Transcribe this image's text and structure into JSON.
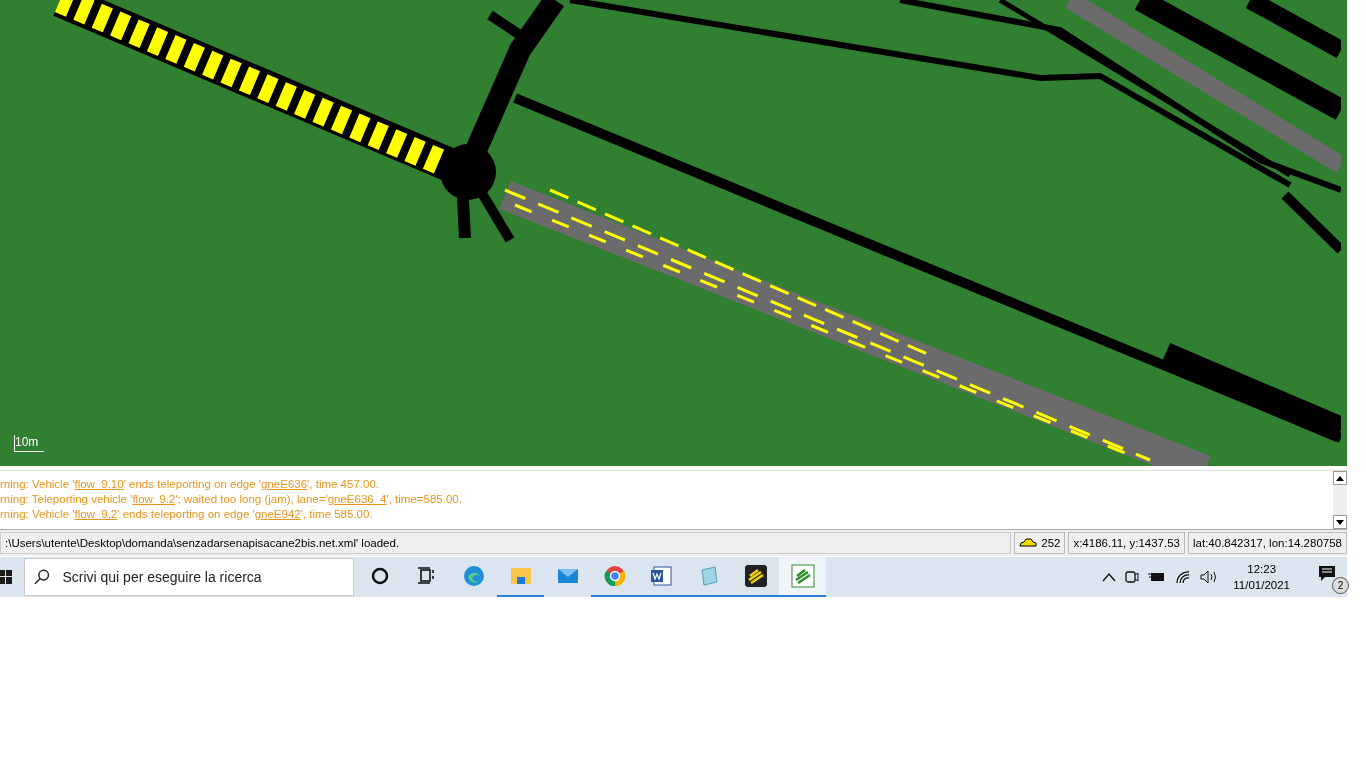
{
  "map": {
    "scale_label": "10m"
  },
  "messages": [
    [
      {
        "text": "rning: Vehicle '",
        "link": false
      },
      {
        "text": "flow_9.10",
        "link": true
      },
      {
        "text": "' ends teleporting on edge '",
        "link": false
      },
      {
        "text": "gneE636",
        "link": true
      },
      {
        "text": "', time 457.00.",
        "link": false
      }
    ],
    [
      {
        "text": "rning: Teleporting vehicle '",
        "link": false
      },
      {
        "text": "flow_9.2",
        "link": true
      },
      {
        "text": "'; waited too long (jam), lane='",
        "link": false
      },
      {
        "text": "gneE636_4",
        "link": true
      },
      {
        "text": "', time=585.00.",
        "link": false
      }
    ],
    [
      {
        "text": "rning: Vehicle '",
        "link": false
      },
      {
        "text": "flow_9.2",
        "link": true
      },
      {
        "text": "' ends teleporting on edge '",
        "link": false
      },
      {
        "text": "gneE942",
        "link": true
      },
      {
        "text": "', time 585.00.",
        "link": false
      }
    ]
  ],
  "status_bar": {
    "message": ":\\Users\\utente\\Desktop\\domanda\\senzadarsenapisacane2bis.net.xml' loaded.",
    "vehicle_count": "252",
    "coordinates": "x:4186.11, y:1437.53",
    "geo": "lat:40.842317, lon:14.280758"
  },
  "taskbar": {
    "search": {
      "placeholder": "Scrivi qui per eseguire la ricerca"
    },
    "apps": [
      {
        "kind": "cortana",
        "running": false,
        "selected": false
      },
      {
        "kind": "taskview",
        "running": false,
        "selected": false
      },
      {
        "kind": "edge",
        "running": false,
        "selected": false
      },
      {
        "kind": "folder",
        "running": true,
        "selected": false
      },
      {
        "kind": "mail",
        "running": false,
        "selected": false
      },
      {
        "kind": "chrome",
        "running": true,
        "selected": false
      },
      {
        "kind": "word",
        "running": true,
        "selected": false
      },
      {
        "kind": "notepad",
        "running": true,
        "selected": false
      },
      {
        "kind": "sumo-yellow",
        "running": true,
        "selected": false
      },
      {
        "kind": "sumo-green",
        "running": true,
        "selected": true
      }
    ],
    "time": "12:23",
    "date": "11/01/2021",
    "notifications": "2"
  }
}
